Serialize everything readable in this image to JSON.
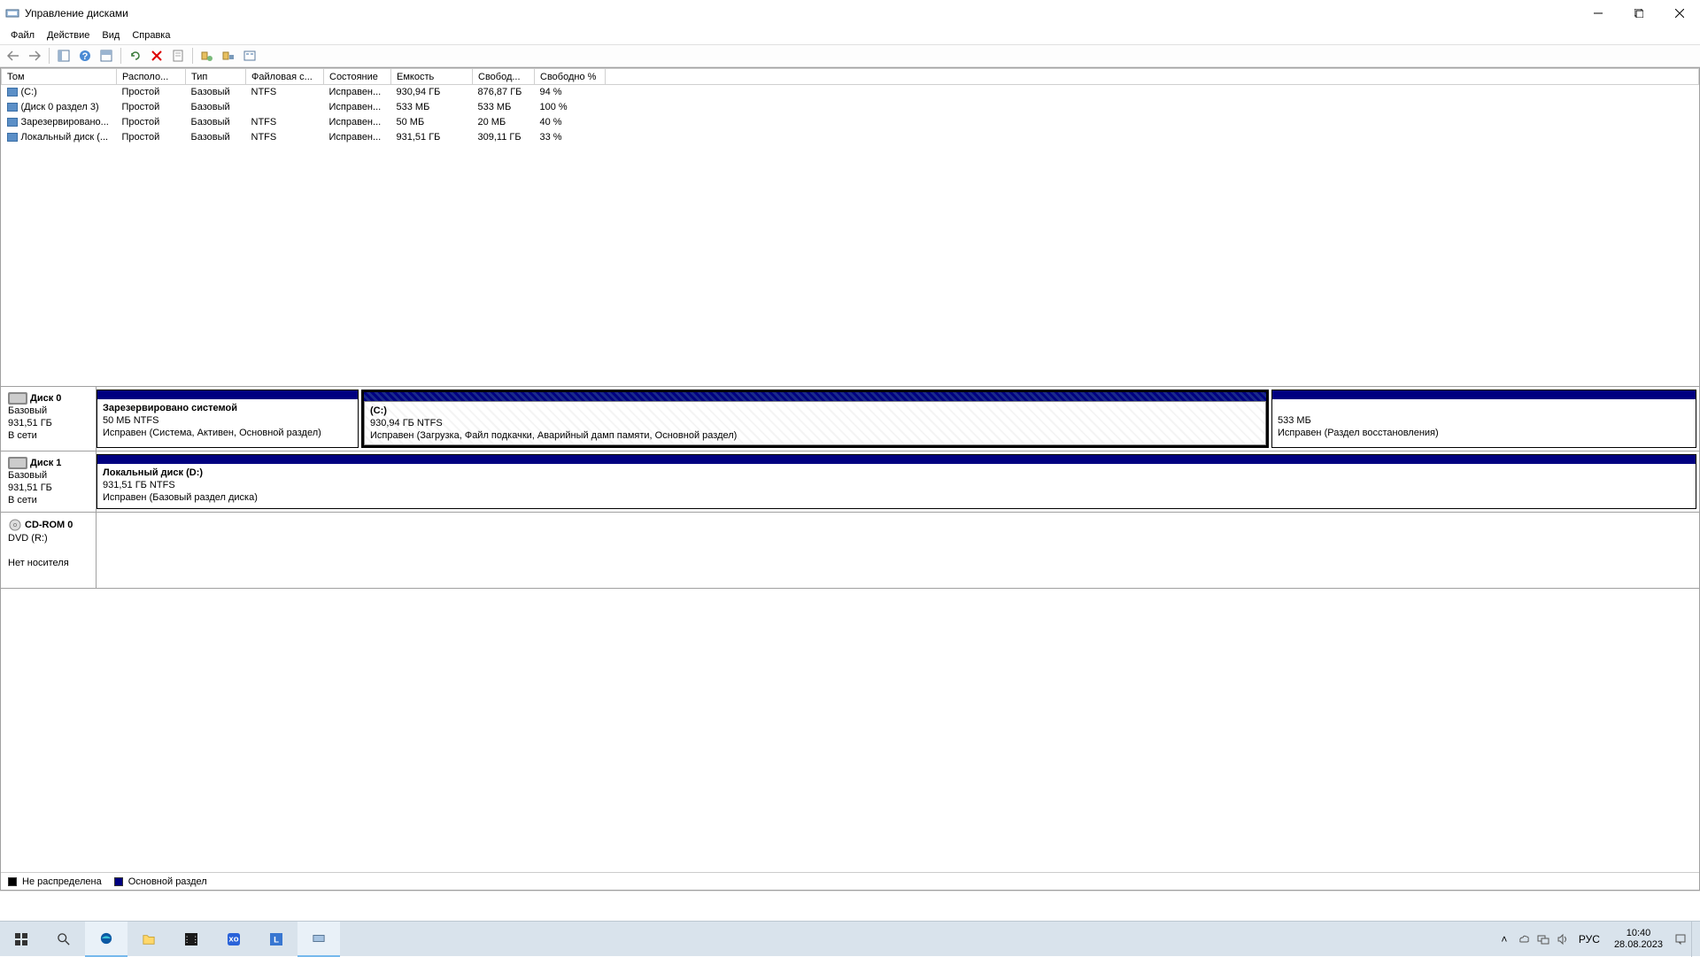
{
  "window": {
    "title": "Управление дисками"
  },
  "menu": {
    "file": "Файл",
    "action": "Действие",
    "view": "Вид",
    "help": "Справка"
  },
  "columns": [
    "Том",
    "Располо...",
    "Тип",
    "Файловая с...",
    "Состояние",
    "Емкость",
    "Свобод...",
    "Свободно %"
  ],
  "volumes": [
    {
      "name": "(C:)",
      "layout": "Простой",
      "type": "Базовый",
      "fs": "NTFS",
      "status": "Исправен...",
      "capacity": "930,94 ГБ",
      "free": "876,87 ГБ",
      "pct": "94 %"
    },
    {
      "name": "(Диск 0 раздел 3)",
      "layout": "Простой",
      "type": "Базовый",
      "fs": "",
      "status": "Исправен...",
      "capacity": "533 МБ",
      "free": "533 МБ",
      "pct": "100 %"
    },
    {
      "name": "Зарезервировано...",
      "layout": "Простой",
      "type": "Базовый",
      "fs": "NTFS",
      "status": "Исправен...",
      "capacity": "50 МБ",
      "free": "20 МБ",
      "pct": "40 %"
    },
    {
      "name": "Локальный диск (...",
      "layout": "Простой",
      "type": "Базовый",
      "fs": "NTFS",
      "status": "Исправен...",
      "capacity": "931,51 ГБ",
      "free": "309,11 ГБ",
      "pct": "33 %"
    }
  ],
  "disks": {
    "disk0": {
      "name": "Диск 0",
      "type": "Базовый",
      "size": "931,51 ГБ",
      "state": "В сети",
      "p1": {
        "title": "Зарезервировано системой",
        "line2": "50 МБ NTFS",
        "line3": "Исправен (Система, Активен, Основной раздел)"
      },
      "p2": {
        "title": "(C:)",
        "line2": "930,94 ГБ NTFS",
        "line3": "Исправен (Загрузка, Файл подкачки, Аварийный дамп памяти, Основной раздел)"
      },
      "p3": {
        "title": "",
        "line2": "533 МБ",
        "line3": "Исправен (Раздел восстановления)"
      }
    },
    "disk1": {
      "name": "Диск 1",
      "type": "Базовый",
      "size": "931,51 ГБ",
      "state": "В сети",
      "p1": {
        "title": "Локальный диск  (D:)",
        "line2": "931,51 ГБ NTFS",
        "line3": "Исправен (Базовый раздел диска)"
      }
    },
    "cdrom": {
      "name": "CD-ROM 0",
      "type": "DVD (R:)",
      "state": "Нет носителя"
    }
  },
  "legend": {
    "unalloc": "Не распределена",
    "primary": "Основной раздел"
  },
  "tray": {
    "lang": "РУС",
    "time": "10:40",
    "date": "28.08.2023"
  }
}
